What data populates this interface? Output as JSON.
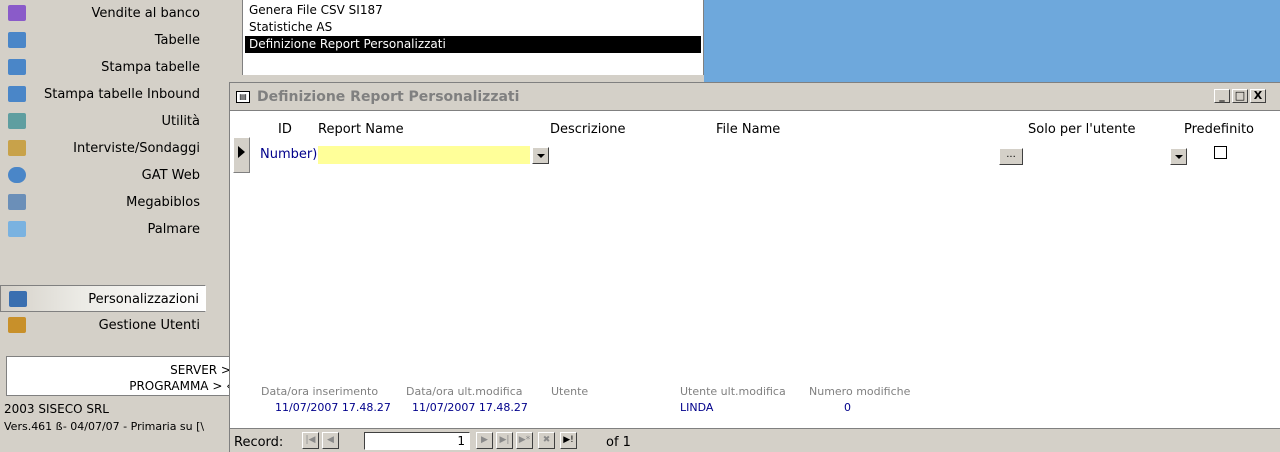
{
  "menu": {
    "items": [
      {
        "label": "Vendite al banco",
        "icon": "cash-register-icon",
        "color": "#8a5bc9"
      },
      {
        "label": "Tabelle",
        "icon": "table-icon",
        "color": "#4a86c8"
      },
      {
        "label": "Stampa tabelle",
        "icon": "print-table-icon",
        "color": "#4a86c8"
      },
      {
        "label": "Stampa tabelle Inbound",
        "icon": "print-inbound-icon",
        "color": "#4a86c8"
      },
      {
        "label": "Utilità",
        "icon": "tools-icon",
        "color": "#5f9ea0"
      },
      {
        "label": "Interviste/Sondaggi",
        "icon": "survey-icon",
        "color": "#c8a24a"
      },
      {
        "label": "GAT Web",
        "icon": "globe-icon",
        "color": "#4a86c8"
      },
      {
        "label": "Megabiblos",
        "icon": "books-icon",
        "color": "#6b8fb8"
      },
      {
        "label": "Palmare",
        "icon": "handheld-icon",
        "color": "#7ab2e0"
      },
      {
        "label": "Personalizzazioni",
        "icon": "customize-icon",
        "color": "#3a6fb0"
      },
      {
        "label": "Gestione Utenti",
        "icon": "users-icon",
        "color": "#c8902a"
      }
    ],
    "server_line": "SERVER >",
    "program_line": "PROGRAMMA > ‹",
    "copyright": "2003 SISECO SRL",
    "version": "Vers.461 ß- 04/07/07 - Primaria su [\\"
  },
  "submenu": {
    "items": [
      "Genera File CSV SI187",
      "Statistiche AS",
      "Definizione Report Personalizzati"
    ]
  },
  "window": {
    "title": "Definizione Report Personalizzati",
    "buttons": [
      "_",
      "□",
      "X"
    ]
  },
  "form": {
    "headers": {
      "id": "ID",
      "report_name": "Report Name",
      "descrizione": "Descrizione",
      "file_name": "File Name",
      "solo_utente": "Solo per l'utente",
      "predefinito": "Predefinito"
    },
    "id_value": "Number)",
    "report_name_value": "",
    "dots_label": "...",
    "predefinito_checked": false,
    "footer": {
      "data_ins_label": "Data/ora inserimento",
      "data_ins_value": "11/07/2007 17.48.27",
      "data_mod_label": "Data/ora ult.modifica",
      "data_mod_value": "11/07/2007 17.48.27",
      "utente_label": "Utente",
      "utente_value": "",
      "utente_mod_label": "Utente ult.modifica",
      "utente_mod_value": "LINDA",
      "num_mod_label": "Numero modifiche",
      "num_mod_value": "0"
    }
  },
  "navigator": {
    "label": "Record:",
    "current": "1",
    "of_text": "of 1",
    "buttons": {
      "first": "|◀",
      "prev": "◀",
      "next": "▶",
      "last": "▶|",
      "new": "▶*",
      "delete": "✖",
      "last_filtered": "▶!"
    }
  }
}
